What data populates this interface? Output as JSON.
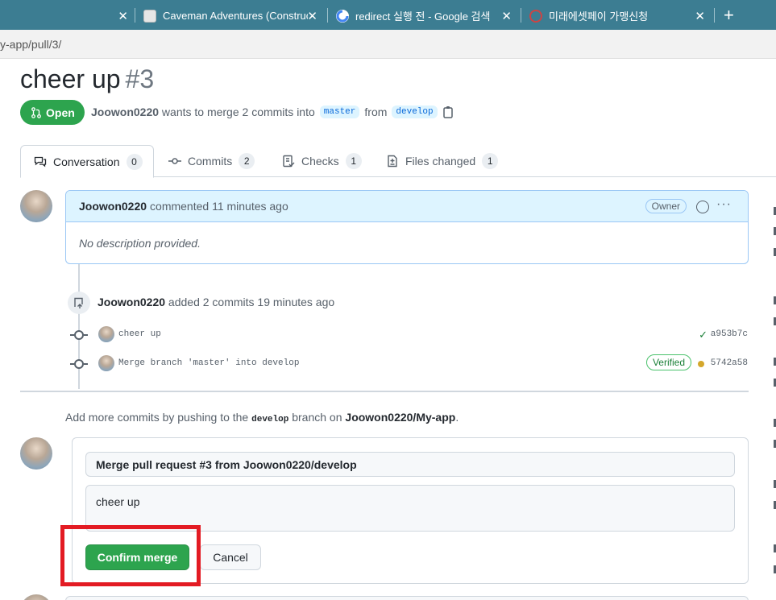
{
  "browser": {
    "tabs": [
      {
        "title": "",
        "close": "✕"
      },
      {
        "title": "Caveman Adventures (Construct",
        "close": "✕"
      },
      {
        "title": "redirect 실행 전 - Google 검색",
        "close": "✕"
      },
      {
        "title": "미래에셋페이 가맹신청",
        "close": "✕"
      }
    ],
    "new_tab": "+",
    "url": "y-app/pull/3/"
  },
  "pr": {
    "title": "cheer up",
    "number": "#3",
    "state": "Open",
    "author": "Joowon0220",
    "merge_text": "wants to merge 2 commits into",
    "base_branch": "master",
    "from_text": "from",
    "head_branch": "develop"
  },
  "tabs": [
    {
      "label": "Conversation",
      "count": "0"
    },
    {
      "label": "Commits",
      "count": "2"
    },
    {
      "label": "Checks",
      "count": "1"
    },
    {
      "label": "Files changed",
      "count": "1"
    }
  ],
  "comment": {
    "author": "Joowon0220",
    "action": "commented 11 minutes ago",
    "badge": "Owner",
    "more": "···",
    "body": "No description provided."
  },
  "push_event": {
    "author": "Joowon0220",
    "action": "added 2 commits 19 minutes ago"
  },
  "commits": [
    {
      "message": "cheer up",
      "sha": "a953b7c",
      "status": "success"
    },
    {
      "message": "Merge branch 'master' into develop",
      "sha": "5742a58",
      "status": "pending",
      "badge": "Verified"
    }
  ],
  "add_more": {
    "prefix": "Add more commits by pushing to the",
    "branch": "develop",
    "middle": "branch on",
    "repo": "Joowon0220/My-app",
    "suffix": "."
  },
  "merge_form": {
    "title_value": "Merge pull request #3 from Joowon0220/develop",
    "message_value": "cheer up",
    "confirm_label": "Confirm merge",
    "cancel_label": "Cancel"
  },
  "colors": {
    "tabbar": "#3c7d92",
    "open_green": "#2da44e",
    "highlight_red": "#e31b23",
    "link_blue": "#0969da"
  }
}
